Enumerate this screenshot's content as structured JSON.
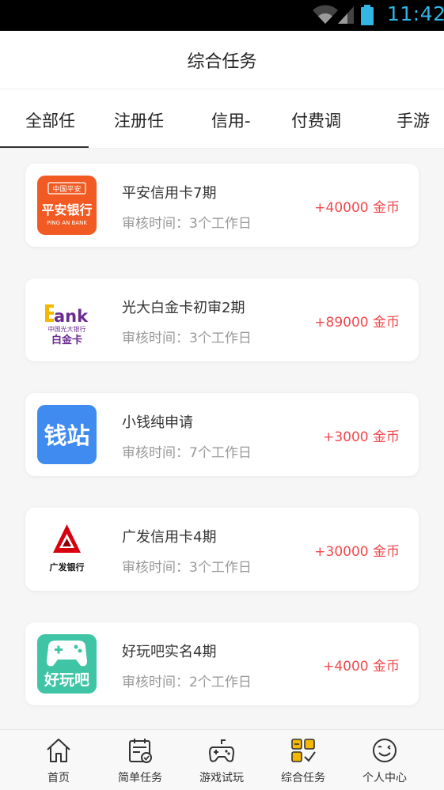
{
  "status_bar": {
    "time": "11:42"
  },
  "header": {
    "title": "综合任务"
  },
  "tabs": [
    {
      "label": "全部任"
    },
    {
      "label": "注册任"
    },
    {
      "label": "信用-"
    },
    {
      "label": "付费调"
    },
    {
      "label": "手游"
    }
  ],
  "tasks": [
    {
      "name": "平安信用卡7期",
      "review": "审核时间：3个工作日",
      "reward": "+40000 金币",
      "logo": {
        "line1": "中国平安",
        "line2": "平安银行",
        "line3": "PING AN BANK"
      }
    },
    {
      "name": "光大白金卡初审2期",
      "review": "审核时间：3个工作日",
      "reward": "+89000 金币",
      "logo": {
        "line1": "Bank",
        "line2": "中国光大银行",
        "line3": "白金卡"
      }
    },
    {
      "name": "小钱纯申请",
      "review": "审核时间：7个工作日",
      "reward": "+3000 金币",
      "logo": {
        "line1": "钱站"
      }
    },
    {
      "name": "广发信用卡4期",
      "review": "审核时间：3个工作日",
      "reward": "+30000 金币",
      "logo": {
        "line1": "广发银行"
      }
    },
    {
      "name": "好玩吧实名4期",
      "review": "审核时间：2个工作日",
      "reward": "+4000 金币",
      "logo": {
        "line1": "好玩吧"
      }
    }
  ],
  "bottom_nav": [
    {
      "label": "首页",
      "icon": "home-icon"
    },
    {
      "label": "简单任务",
      "icon": "calendar-check-icon"
    },
    {
      "label": "游戏试玩",
      "icon": "gamepad-icon"
    },
    {
      "label": "综合任务",
      "icon": "grid-check-icon",
      "active": true
    },
    {
      "label": "个人中心",
      "icon": "smile-icon"
    }
  ],
  "colors": {
    "accent": "#f2474b",
    "status_time": "#33b5e5",
    "active_icon": "#f5b800"
  }
}
